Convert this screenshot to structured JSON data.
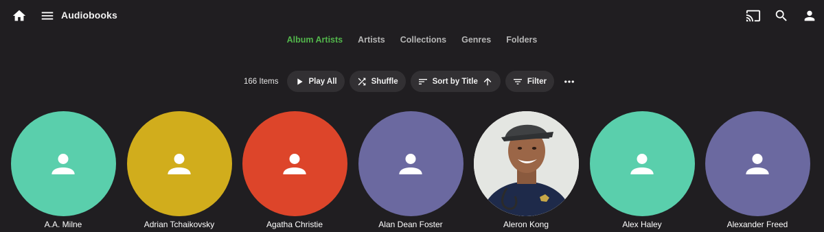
{
  "header": {
    "title": "Audiobooks",
    "icons": [
      "home-icon",
      "menu-icon",
      "cast-icon",
      "search-icon",
      "user-icon"
    ]
  },
  "tabs": [
    {
      "label": "Album Artists",
      "active": true
    },
    {
      "label": "Artists",
      "active": false
    },
    {
      "label": "Collections",
      "active": false
    },
    {
      "label": "Genres",
      "active": false
    },
    {
      "label": "Folders",
      "active": false
    }
  ],
  "toolbar": {
    "item_count": "166 Items",
    "play_all": "Play All",
    "shuffle": "Shuffle",
    "sort": "Sort by Title",
    "filter": "Filter"
  },
  "colors": {
    "background": "#201e21",
    "accent": "#52b54b",
    "button_bg": "#323033"
  },
  "artists": [
    {
      "name": "A.A. Milne",
      "color": "#5acfac",
      "has_photo": false
    },
    {
      "name": "Adrian Tchaikovsky",
      "color": "#d1ad1c",
      "has_photo": false
    },
    {
      "name": "Agatha Christie",
      "color": "#dd452a",
      "has_photo": false
    },
    {
      "name": "Alan Dean Foster",
      "color": "#6b69a0",
      "has_photo": false
    },
    {
      "name": "Aleron Kong",
      "color": "#ffffff",
      "has_photo": true
    },
    {
      "name": "Alex Haley",
      "color": "#5acfac",
      "has_photo": false
    },
    {
      "name": "Alexander Freed",
      "color": "#6b69a0",
      "has_photo": false
    }
  ]
}
